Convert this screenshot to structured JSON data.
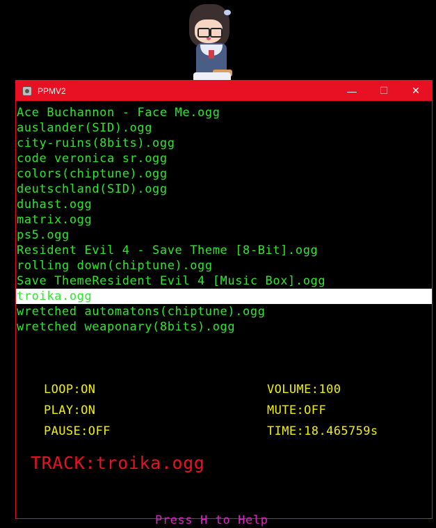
{
  "window": {
    "title": "PPMV2",
    "controls": {
      "minimize": "—",
      "maximize": "☐",
      "close": "✕"
    },
    "accent_color": "#e81123"
  },
  "files": [
    "Ace Buchannon - Face Me.ogg",
    "auslander(SID).ogg",
    "city-ruins(8bits).ogg",
    "code veronica sr.ogg",
    "colors(chiptune).ogg",
    "deutschland(SID).ogg",
    "duhast.ogg",
    "matrix.ogg",
    "ps5.ogg",
    "Resident Evil 4 - Save Theme [8-Bit].ogg",
    "rolling down(chiptune).ogg",
    "Save ThemeResident Evil 4 [Music Box].ogg",
    "troika.ogg",
    "wretched automatons(chiptune).ogg",
    "wretched weaponary(8bits).ogg"
  ],
  "selected_index": 12,
  "status": {
    "loop": "LOOP:ON",
    "play": "PLAY:ON",
    "pause": "PAUSE:OFF",
    "volume": "VOLUME:100",
    "mute": "MUTE:OFF",
    "time": "TIME:18.465759s"
  },
  "track": "TRACK:troika.ogg",
  "help": "Press H to Help",
  "colors": {
    "list_text": "#2ee62e",
    "status_text": "#f0f000",
    "track_text": "#e81123",
    "help_text": "#e020c8",
    "selection_bg": "#ffffff"
  }
}
